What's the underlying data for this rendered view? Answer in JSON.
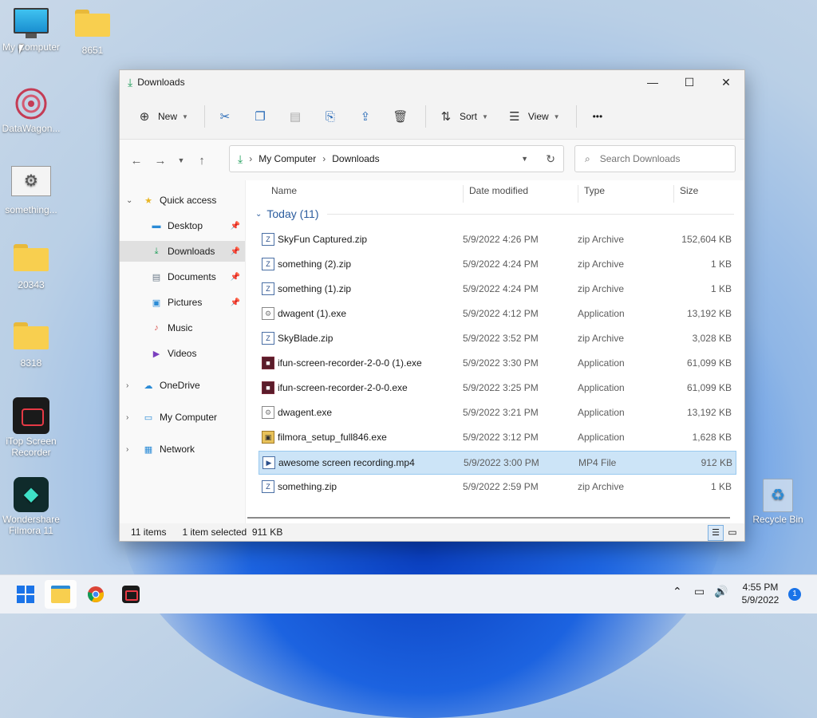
{
  "desktop": {
    "icons": [
      {
        "label": "My Computer"
      },
      {
        "label": "8651"
      },
      {
        "label": "DataWagon..."
      },
      {
        "label": "something..."
      },
      {
        "label": "20343"
      },
      {
        "label": "8318"
      },
      {
        "label": "iTop Screen Recorder"
      },
      {
        "label": "Wondershare Filmora 11"
      },
      {
        "label": "Recycle Bin"
      }
    ]
  },
  "window": {
    "title": "Downloads",
    "controls": {
      "minimize": "—",
      "maximize": "☐",
      "close": "✕"
    },
    "commandbar": {
      "new_label": "New",
      "sort_label": "Sort",
      "view_label": "View",
      "more": "•••"
    },
    "address": {
      "crumbs": [
        "My Computer",
        "Downloads"
      ],
      "search_placeholder": "Search Downloads"
    },
    "nav": {
      "quick_access": "Quick access",
      "items": [
        {
          "label": "Desktop",
          "pinned": true
        },
        {
          "label": "Downloads",
          "pinned": true,
          "selected": true
        },
        {
          "label": "Documents",
          "pinned": true
        },
        {
          "label": "Pictures",
          "pinned": true
        },
        {
          "label": "Music",
          "pinned": false
        },
        {
          "label": "Videos",
          "pinned": false
        }
      ],
      "onedrive": "OneDrive",
      "my_computer": "My Computer",
      "network": "Network"
    },
    "columns": {
      "name": "Name",
      "date": "Date modified",
      "type": "Type",
      "size": "Size"
    },
    "group_label": "Today (11)",
    "files": [
      {
        "name": "SkyFun Captured.zip",
        "date": "5/9/2022 4:26 PM",
        "type": "zip Archive",
        "size": "152,604 KB"
      },
      {
        "name": "something (2).zip",
        "date": "5/9/2022 4:24 PM",
        "type": "zip Archive",
        "size": "1 KB"
      },
      {
        "name": "something (1).zip",
        "date": "5/9/2022 4:24 PM",
        "type": "zip Archive",
        "size": "1 KB"
      },
      {
        "name": "dwagent (1).exe",
        "date": "5/9/2022 4:12 PM",
        "type": "Application",
        "size": "13,192 KB"
      },
      {
        "name": "SkyBlade.zip",
        "date": "5/9/2022 3:52 PM",
        "type": "zip Archive",
        "size": "3,028 KB"
      },
      {
        "name": "ifun-screen-recorder-2-0-0 (1).exe",
        "date": "5/9/2022 3:30 PM",
        "type": "Application",
        "size": "61,099 KB"
      },
      {
        "name": "ifun-screen-recorder-2-0-0.exe",
        "date": "5/9/2022 3:25 PM",
        "type": "Application",
        "size": "61,099 KB"
      },
      {
        "name": "dwagent.exe",
        "date": "5/9/2022 3:21 PM",
        "type": "Application",
        "size": "13,192 KB"
      },
      {
        "name": "filmora_setup_full846.exe",
        "date": "5/9/2022 3:12 PM",
        "type": "Application",
        "size": "1,628 KB"
      },
      {
        "name": "awesome screen recording.mp4",
        "date": "5/9/2022 3:00 PM",
        "type": "MP4 File",
        "size": "912 KB",
        "selected": true
      },
      {
        "name": "something.zip",
        "date": "5/9/2022 2:59 PM",
        "type": "zip Archive",
        "size": "1 KB"
      }
    ],
    "status": {
      "count": "11 items",
      "selection": "1 item selected  911 KB"
    }
  },
  "taskbar": {
    "time": "4:55 PM",
    "date": "5/9/2022",
    "notifications": "1"
  }
}
